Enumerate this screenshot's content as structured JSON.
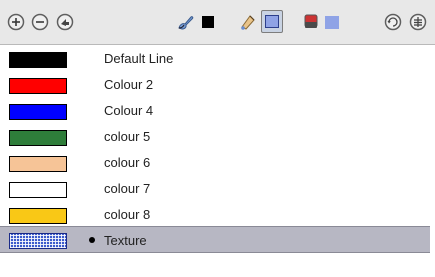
{
  "toolbar": {
    "buttons": [
      {
        "name": "add-colour",
        "icon": "plus-circle-icon"
      },
      {
        "name": "remove-colour",
        "icon": "minus-circle-icon"
      },
      {
        "name": "colour-options",
        "icon": "options-arrow-icon"
      },
      {
        "name": "line-colour",
        "icon": "brush-icon",
        "colour": "#000000"
      },
      {
        "name": "fill-colour",
        "icon": "paint-bucket-icon",
        "colour": "#8fa3e6"
      },
      {
        "name": "texture-colour",
        "icon": "texture-icon",
        "colour": "#8fa3e6"
      },
      {
        "name": "refresh",
        "icon": "refresh-icon"
      },
      {
        "name": "menu",
        "icon": "menu-icon"
      }
    ]
  },
  "colours": [
    {
      "label": "Default Line",
      "colour": "#000000",
      "selected": false
    },
    {
      "label": "Colour 2",
      "colour": "#ff0000",
      "selected": false
    },
    {
      "label": "Colour 4",
      "colour": "#0000ff",
      "selected": false
    },
    {
      "label": "colour 5",
      "colour": "#2e7d3a",
      "selected": false
    },
    {
      "label": "colour 6",
      "colour": "#f6c497",
      "selected": false
    },
    {
      "label": "colour 7",
      "colour": "#ffffff",
      "selected": false
    },
    {
      "label": "colour 8",
      "colour": "#f9c816",
      "selected": false
    },
    {
      "label": "Texture",
      "colour": "texture",
      "selected": true
    }
  ]
}
